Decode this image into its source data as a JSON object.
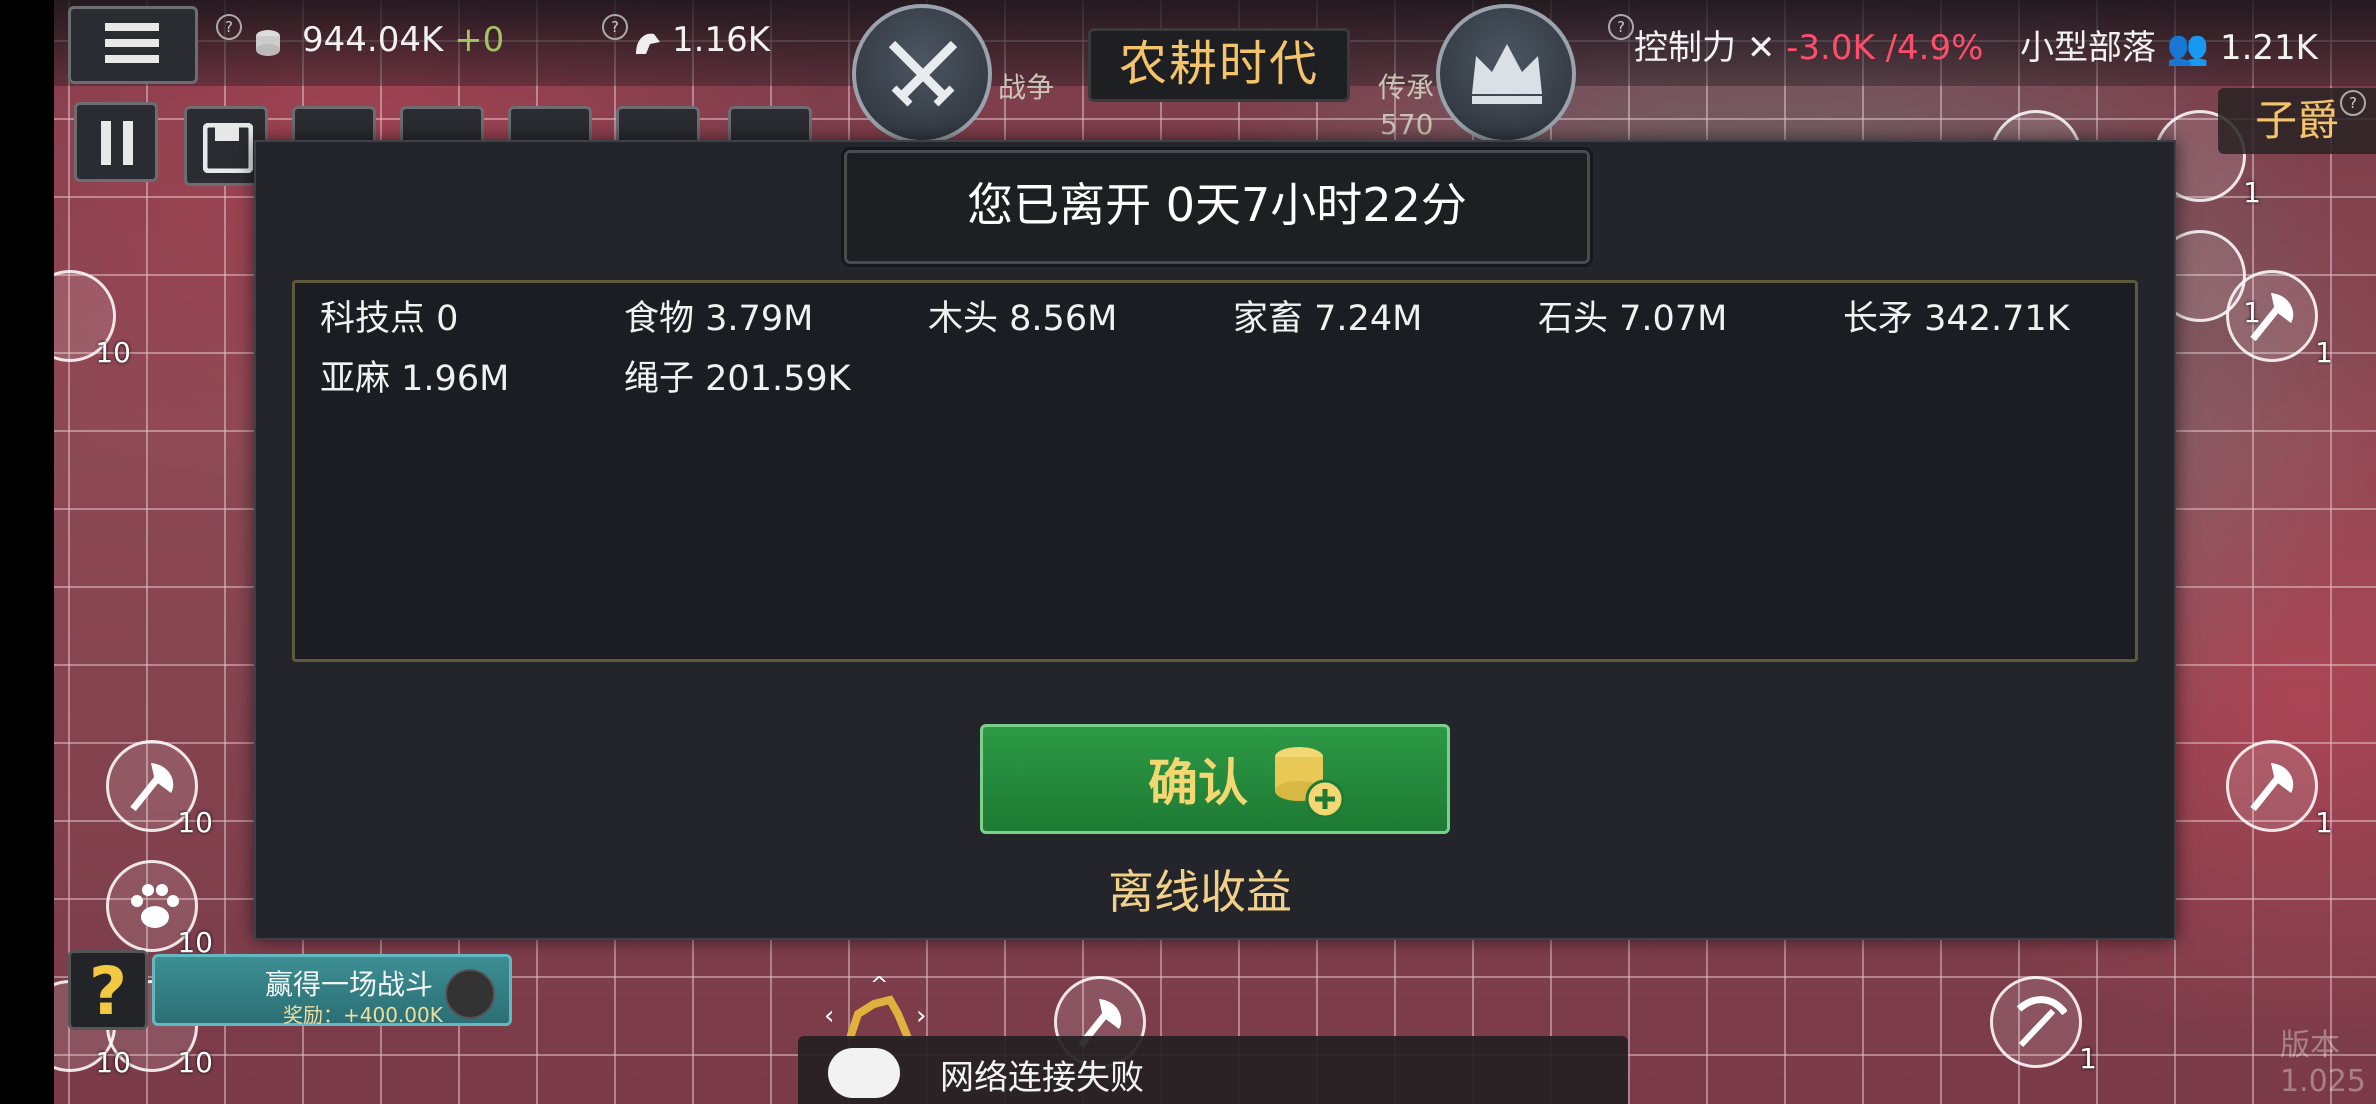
{
  "topbar": {
    "gold": "944.04K",
    "gold_delta": "+0",
    "strength": "1.16K",
    "war_label": "战争",
    "era": "农耕时代",
    "heritage_label": "传承",
    "heritage_value": "570",
    "control_label": "控制力",
    "control_value": "-3.0K /4.9%",
    "tribe_label": "小型部落",
    "population": "1.21K",
    "rank": "子爵"
  },
  "dialog": {
    "title": "您已离开 0天7小时22分",
    "rewards": [
      {
        "name": "科技点",
        "value": "0"
      },
      {
        "name": "食物",
        "value": "3.79M"
      },
      {
        "name": "木头",
        "value": "8.56M"
      },
      {
        "name": "家畜",
        "value": "7.24M"
      },
      {
        "name": "石头",
        "value": "7.07M"
      },
      {
        "name": "长矛",
        "value": "342.71K"
      },
      {
        "name": "亚麻",
        "value": "1.96M"
      },
      {
        "name": "绳子",
        "value": "201.59K"
      }
    ],
    "confirm_label": "确认",
    "offline_label": "离线收益"
  },
  "quest": {
    "help": "?",
    "title": "赢得一场战斗",
    "reward": "奖励：+400.00K"
  },
  "chat": {
    "message": "网络连接失败"
  },
  "version": "版本1.025",
  "tiles": {
    "counts": [
      "10",
      "10",
      "10",
      "10",
      "10",
      "1",
      "1",
      "1",
      "1",
      "1",
      "1"
    ]
  },
  "colors": {
    "accent_gold": "#f3c46b",
    "confirm_green": "#2c9a46",
    "negative_red": "#ff4d6d"
  }
}
